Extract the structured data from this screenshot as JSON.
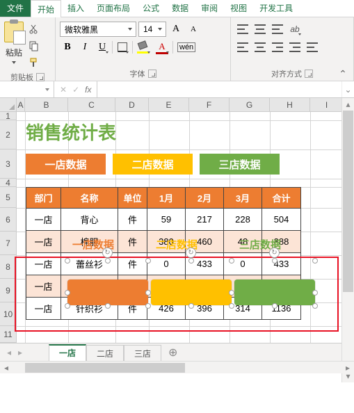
{
  "tabs": {
    "file": "文件",
    "home": "开始",
    "insert": "插入",
    "pagelayout": "页面布局",
    "formulas": "公式",
    "data": "数据",
    "review": "审阅",
    "view": "视图",
    "developer": "开发工具"
  },
  "ribbon": {
    "paste": "粘贴",
    "clipboard": "剪贴板",
    "font_name": "微软雅黑",
    "font_size": "14",
    "font_group": "字体",
    "align_group": "对齐方式"
  },
  "formula_bar": {
    "name_box": "",
    "cancel": "✕",
    "confirm": "✓",
    "fx": "fx",
    "value": ""
  },
  "columns": [
    "A",
    "B",
    "C",
    "D",
    "E",
    "F",
    "G",
    "H",
    "I"
  ],
  "rows": [
    "1",
    "2",
    "3",
    "4",
    "5",
    "6",
    "7",
    "8",
    "9",
    "10",
    "11"
  ],
  "content": {
    "title": "销售统计表",
    "chips": {
      "a": "一店数据",
      "b": "二店数据",
      "c": "三店数据"
    },
    "headers": [
      "部门",
      "名称",
      "单位",
      "1月",
      "2月",
      "3月",
      "合计"
    ],
    "table": [
      [
        "一店",
        "背心",
        "件",
        "59",
        "217",
        "228",
        "504"
      ],
      [
        "一店",
        "棉服",
        "件",
        "380",
        "460",
        "48",
        "888"
      ],
      [
        "一店",
        "蕾丝衫",
        "件",
        "0",
        "433",
        "0",
        "433"
      ],
      [
        "一店",
        "",
        "",
        "",
        "",
        "",
        ""
      ],
      [
        "一店",
        "针织衫",
        "件",
        "426",
        "396",
        "314",
        "1136"
      ]
    ],
    "overlay": {
      "a": "一店数据",
      "b": "二店数据",
      "c": "三店数据"
    }
  },
  "sheet_tabs": {
    "s1": "一店",
    "s2": "二店",
    "s3": "三店"
  },
  "chart_data": {
    "type": "table",
    "title": "销售统计表",
    "columns": [
      "部门",
      "名称",
      "单位",
      "1月",
      "2月",
      "3月",
      "合计"
    ],
    "rows": [
      [
        "一店",
        "背心",
        "件",
        59,
        217,
        228,
        504
      ],
      [
        "一店",
        "棉服",
        "件",
        380,
        460,
        48,
        888
      ],
      [
        "一店",
        "蕾丝衫",
        "件",
        0,
        433,
        0,
        433
      ],
      [
        "一店",
        "针织衫",
        "件",
        426,
        396,
        314,
        1136
      ]
    ]
  }
}
